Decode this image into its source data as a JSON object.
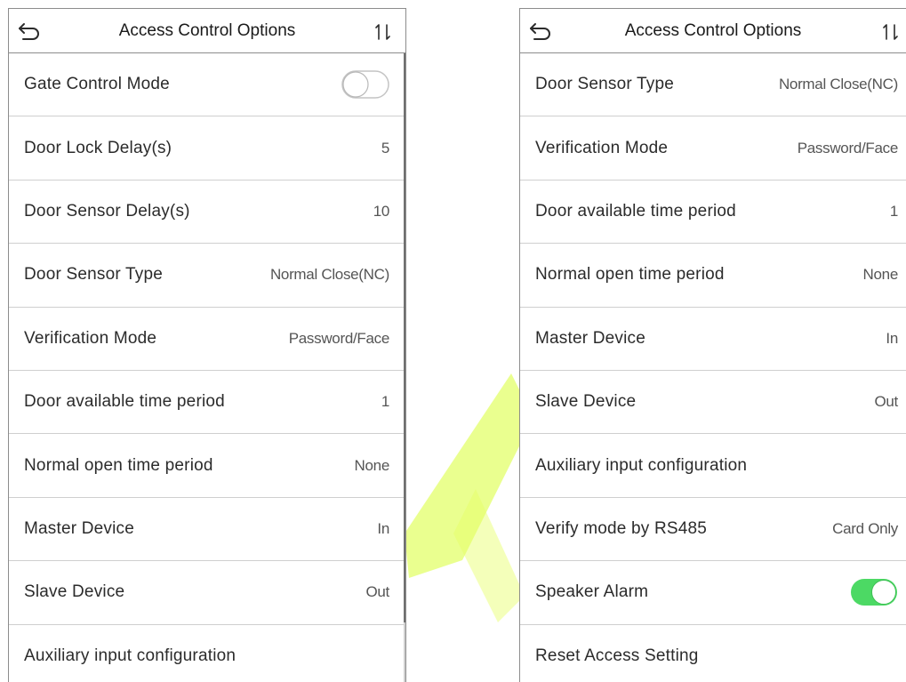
{
  "colors": {
    "toggle_on": "#4cd964",
    "toggle_off_border": "#c4c4c4",
    "watermark": "#d9ff33"
  },
  "left_screen": {
    "title": "Access Control Options",
    "back_icon": "back-arrow-icon",
    "sort_icon": "sort-arrows-icon",
    "rows": [
      {
        "label": "Gate Control Mode",
        "toggle_on": false
      },
      {
        "label": "Door Lock Delay(s)",
        "value": "5"
      },
      {
        "label": "Door Sensor Delay(s)",
        "value": "10"
      },
      {
        "label": "Door Sensor Type",
        "value": "Normal Close(NC)"
      },
      {
        "label": "Verification Mode",
        "value": "Password/Face"
      },
      {
        "label": "Door available time period",
        "value": "1"
      },
      {
        "label": "Normal open time period",
        "value": "None"
      },
      {
        "label": "Master Device",
        "value": "In"
      },
      {
        "label": "Slave Device",
        "value": "Out"
      },
      {
        "label": "Auxiliary input configuration",
        "value": ""
      }
    ]
  },
  "right_screen": {
    "title": "Access Control Options",
    "back_icon": "back-arrow-icon",
    "sort_icon": "sort-arrows-icon",
    "rows": [
      {
        "label": "Door Sensor Type",
        "value": "Normal Close(NC)"
      },
      {
        "label": "Verification Mode",
        "value": "Password/Face"
      },
      {
        "label": "Door available time period",
        "value": "1"
      },
      {
        "label": "Normal open time period",
        "value": "None"
      },
      {
        "label": "Master Device",
        "value": "In"
      },
      {
        "label": "Slave Device",
        "value": "Out"
      },
      {
        "label": "Auxiliary input configuration",
        "value": ""
      },
      {
        "label": "Verify mode by RS485",
        "value": "Card Only"
      },
      {
        "label": "Speaker Alarm",
        "toggle_on": true
      },
      {
        "label": "Reset Access Setting",
        "value": ""
      }
    ]
  }
}
